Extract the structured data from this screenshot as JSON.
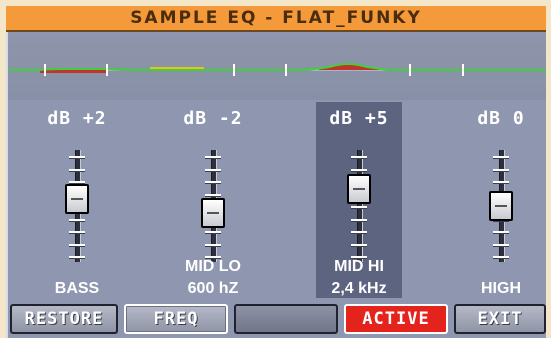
{
  "window": {
    "title": "SAMPLE EQ - FLAT_FUNKY"
  },
  "bands": [
    {
      "db": "dB  +2",
      "name": "BASS",
      "freq": "",
      "gain_db": 2,
      "active": false
    },
    {
      "db": "dB  -2",
      "name": "MID LO",
      "freq": "600 hZ",
      "gain_db": -2,
      "active": false
    },
    {
      "db": "dB  +5",
      "name": "MID HI",
      "freq": "2,4 kHz",
      "gain_db": 5,
      "active": true
    },
    {
      "db": "dB  0",
      "name": "HIGH",
      "freq": "",
      "gain_db": 0,
      "active": false
    }
  ],
  "buttons": {
    "restore": "RESTORE",
    "freq": "FREQ",
    "blank": "",
    "active": "ACTIVE",
    "exit": "EXIT"
  },
  "colors": {
    "title_bar": "#f59a3b",
    "panel": "#8f96b0",
    "active_button": "#e3231c",
    "curve_green": "#3fd13a",
    "curve_red": "#c0342c",
    "curve_yellow": "#e6c21a"
  }
}
